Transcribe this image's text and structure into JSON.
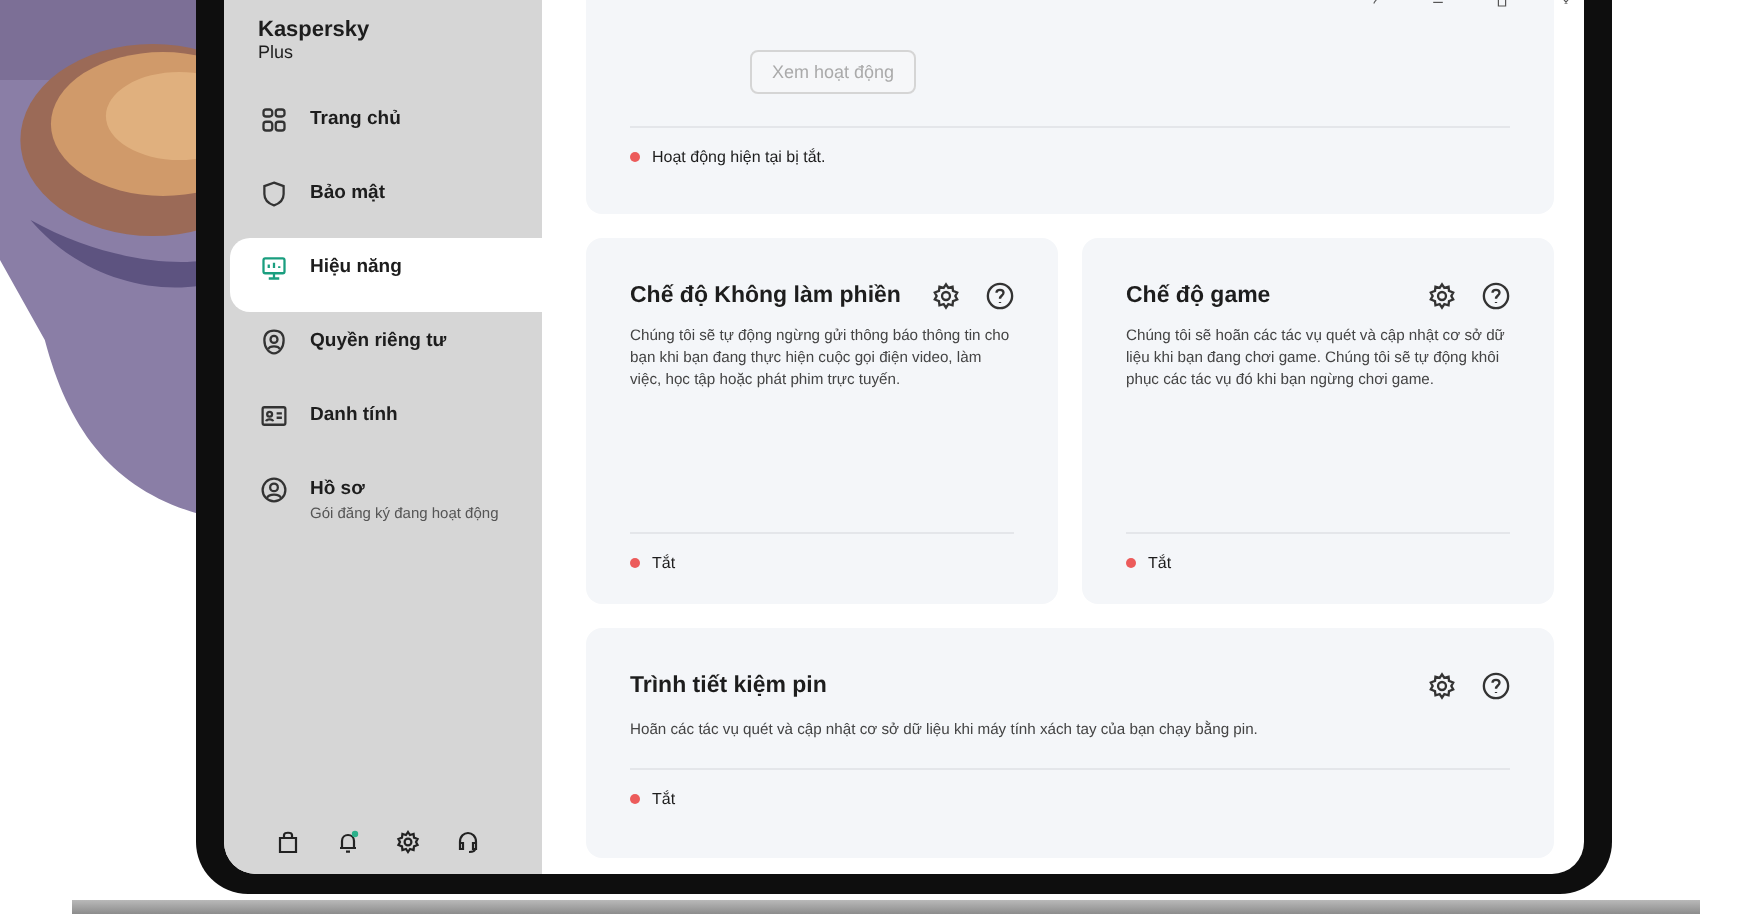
{
  "sidebar": {
    "brand": "Kaspersky",
    "edition": "Plus",
    "items": [
      {
        "label": "Trang chủ",
        "selected": false
      },
      {
        "label": "Bảo mật",
        "selected": false
      },
      {
        "label": "Hiệu năng",
        "selected": true
      },
      {
        "label": "Quyền riêng tư",
        "selected": false
      },
      {
        "label": "Danh tính",
        "selected": false
      },
      {
        "label": "Hồ sơ",
        "sublabel": "Gói đăng ký đang hoạt động",
        "selected": false
      }
    ]
  },
  "activity_card": {
    "button": {
      "label": "Xem hoạt động",
      "disabled": true
    },
    "status": {
      "text": "Hoạt động hiện tại bị tắt.",
      "on": false
    }
  },
  "cards": [
    {
      "title": "Chế độ Không làm phiền",
      "description": "Chúng tôi sẽ tự động ngừng gửi thông báo thông tin cho bạn khi bạn đang thực hiện cuộc gọi điện video, làm việc, học tập hoặc phát phim trực tuyến.",
      "status": {
        "text": "Tắt",
        "on": false
      }
    },
    {
      "title": "Chế độ game",
      "description": "Chúng tôi sẽ hoãn các tác vụ quét và cập nhật cơ sở dữ liệu khi bạn đang chơi game. Chúng tôi sẽ tự động khôi phục các tác vụ đó khi bạn ngừng chơi game.",
      "status": {
        "text": "Tắt",
        "on": false
      }
    },
    {
      "title": "Trình tiết kiệm pin",
      "description": "Hoãn các tác vụ quét và cập nhật cơ sở dữ liệu khi máy tính xách tay của bạn chạy bằng pin.",
      "status": {
        "text": "Tắt",
        "on": false
      }
    }
  ]
}
